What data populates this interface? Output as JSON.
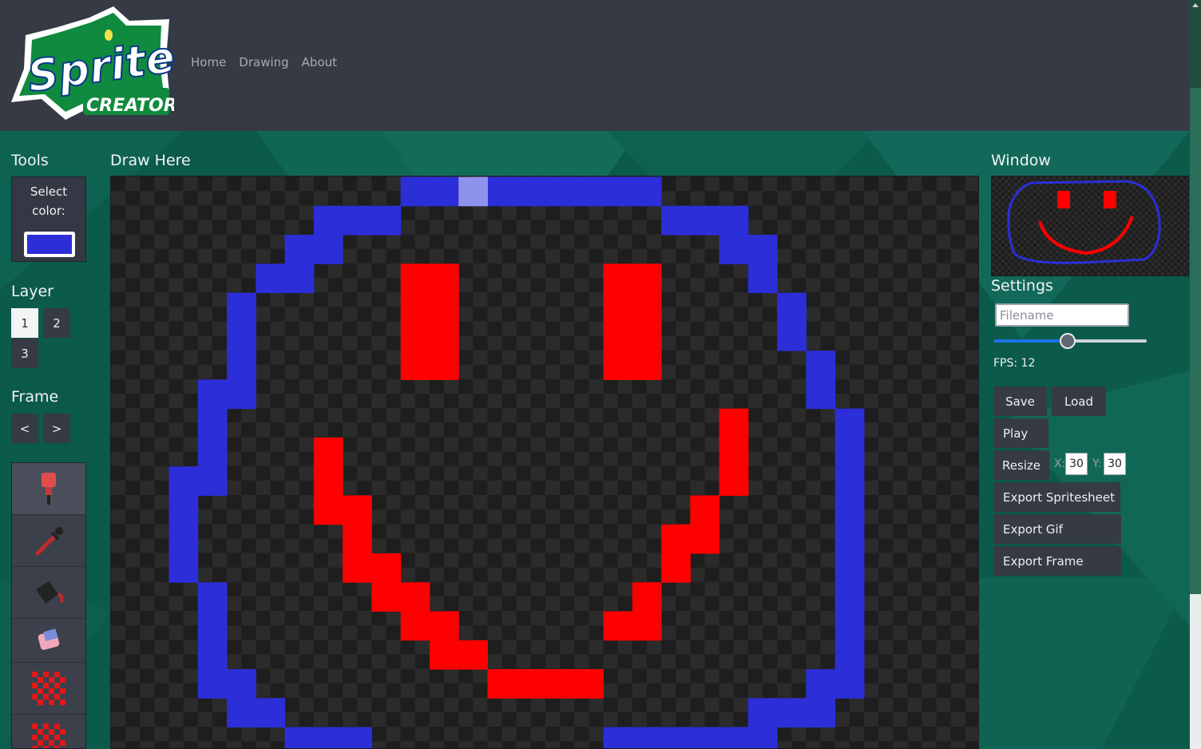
{
  "header": {
    "logo_text_top": "Sprite",
    "logo_text_bottom": "CREATOR",
    "nav": [
      {
        "label": "Home"
      },
      {
        "label": "Drawing"
      },
      {
        "label": "About"
      }
    ]
  },
  "tools": {
    "title": "Tools",
    "select_color_label": "Select color:",
    "selected_color": "#2c2ed8",
    "items": [
      {
        "name": "marker-icon",
        "active": true
      },
      {
        "name": "eyedropper-icon"
      },
      {
        "name": "paint-bucket-icon"
      },
      {
        "name": "eraser-icon"
      },
      {
        "name": "red-checker-icon"
      },
      {
        "name": "red-checker-icon"
      }
    ]
  },
  "layer": {
    "title": "Layer",
    "buttons": [
      "1",
      "2",
      "3"
    ],
    "active": "1"
  },
  "frame": {
    "title": "Frame",
    "prev": "<",
    "next": ">"
  },
  "canvas": {
    "title": "Draw Here",
    "grid_width": 30,
    "grid_height": 30,
    "colors": {
      "blue": "#2c2ed8",
      "red": "#ff0000",
      "light": "#8f92ec",
      "checker_dark": "#1e1e1e",
      "checker_light": "#2b2b2b"
    }
  },
  "window": {
    "title": "Window"
  },
  "settings": {
    "title": "Settings",
    "filename_placeholder": "Filename",
    "fps_label": "FPS: 12",
    "fps_fraction": 0.48,
    "save": "Save",
    "load": "Load",
    "play": "Play",
    "resize": "Resize",
    "x_label": "X:",
    "x_value": "30",
    "y_label": "Y:",
    "y_value": "30",
    "export_spritesheet": "Export Spritesheet",
    "export_gif": "Export Gif",
    "export_frame": "Export Frame"
  }
}
